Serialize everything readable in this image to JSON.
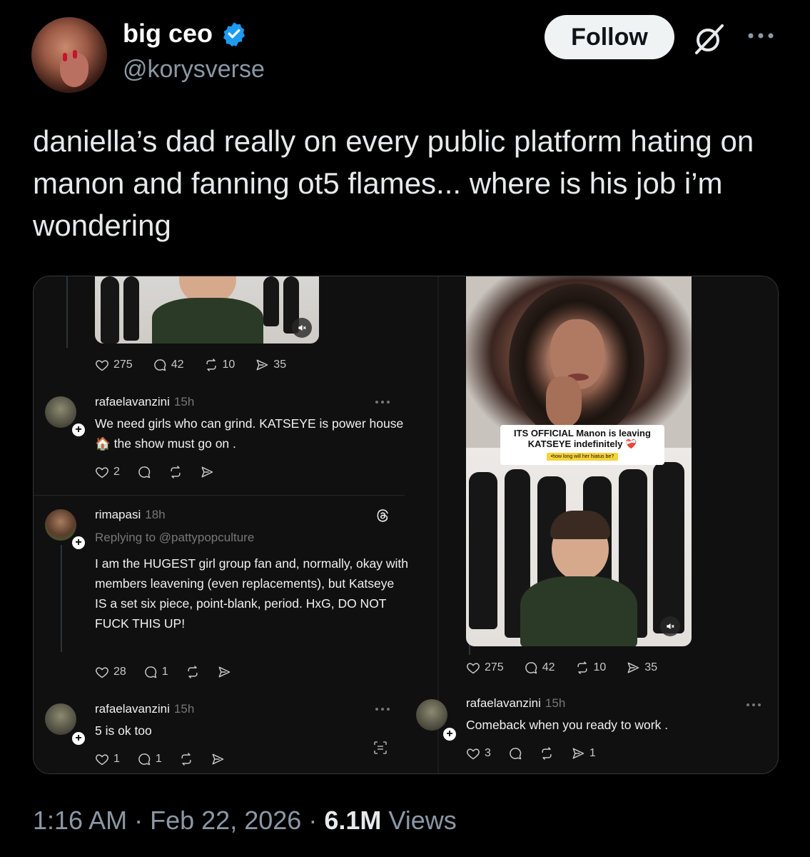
{
  "author": {
    "display_name": "big ceo",
    "handle": "@korysverse",
    "verified": true
  },
  "follow_label": "Follow",
  "icons": [
    "verified-badge-icon",
    "grok-icon",
    "more-options-icon",
    "heart-icon",
    "comment-icon",
    "repost-icon",
    "share-icon",
    "threads-logo-icon",
    "mute-icon"
  ],
  "tweet_text": "daniella’s dad really on every public platform hating on manon and fanning ot5 flames... where is his job i’m wondering",
  "media": {
    "left_panel": {
      "top_stats": {
        "likes": "275",
        "comments": "42",
        "reposts": "10",
        "shares": "35"
      },
      "posts": [
        {
          "username": "rafaelavanzini",
          "time": "15h",
          "text_before": "We need girls who can grind. KATSEYE is power house",
          "emoji": "🏠",
          "text_after": "the show must go on .",
          "stats": {
            "likes": "2",
            "comments": "",
            "reposts": "",
            "shares": ""
          }
        },
        {
          "username": "rimapasi",
          "time": "18h",
          "replying_to": "Replying to @pattypopculture",
          "text": "I am the HUGEST girl group fan and, normally, okay with members leavening (even replacements), but Katseye IS a set six piece, point-blank, period.  HxG, DO NOT FUCK THIS UP!",
          "stats": {
            "likes": "28",
            "comments": "1",
            "reposts": "",
            "shares": ""
          }
        },
        {
          "username": "rafaelavanzini",
          "time": "15h",
          "text": "5 is ok too",
          "stats": {
            "likes": "1",
            "comments": "1",
            "reposts": "",
            "shares": ""
          }
        }
      ]
    },
    "right_panel": {
      "banner_title": "ITS OFFICIAL Manon is leaving KATSEYE indefinitely ❤️‍🩹",
      "banner_sub": "•how long will her hiatus be?",
      "stats": {
        "likes": "275",
        "comments": "42",
        "reposts": "10",
        "shares": "35"
      },
      "post": {
        "username": "rafaelavanzini",
        "time": "15h",
        "text": "Comeback when you ready to work .",
        "stats": {
          "likes": "3",
          "comments": "",
          "reposts": "",
          "shares": "1"
        }
      }
    }
  },
  "footer": {
    "time": "1:16 AM",
    "sep1": "·",
    "date": "Feb 22, 2026",
    "sep2": "·",
    "views_count": "6.1M",
    "views_label": "Views"
  },
  "colors": {
    "background": "#000000",
    "verified": "#1d9bf0",
    "muted_text": "#8b98a5",
    "follow_bg": "#eff3f4"
  }
}
